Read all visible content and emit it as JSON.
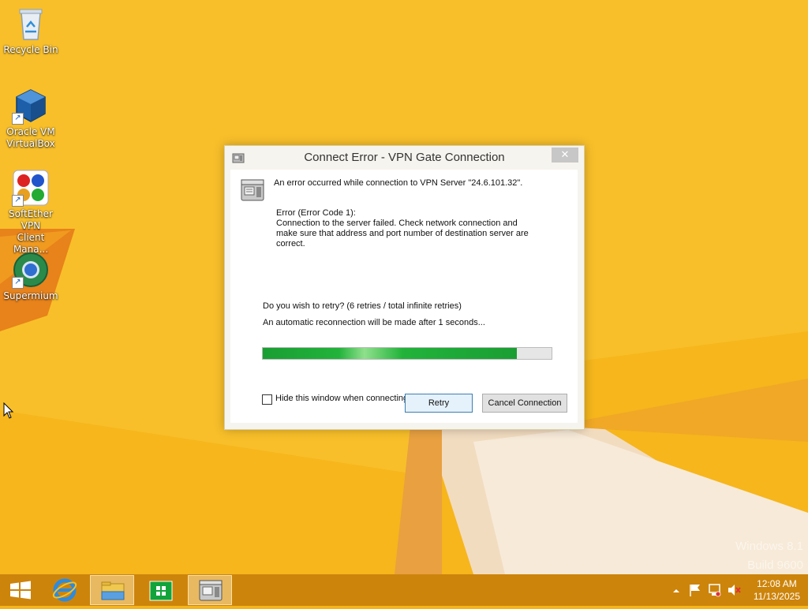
{
  "desktop": {
    "icons": [
      {
        "label": "Recycle Bin",
        "icon": "recycle-bin-icon"
      },
      {
        "label_line1": "Oracle VM",
        "label_line2": "VirtualBox",
        "icon": "virtualbox-icon"
      },
      {
        "label_line1": "SoftEther VPN",
        "label_line2": "Client Mana...",
        "icon": "softether-vpn-icon"
      },
      {
        "label": "Supermium",
        "icon": "supermium-browser-icon"
      }
    ],
    "watermark_line1": "Windows 8.1",
    "watermark_line2": "Build 9600"
  },
  "dialog": {
    "title": "Connect Error - VPN Gate Connection",
    "close_glyph": "✕",
    "message": "An error occurred while connection to VPN Server \"24.6.101.32\".",
    "error_code": "Error (Error Code 1):",
    "error_line1": "Connection to the server failed. Check network connection and",
    "error_line2": "make sure that address and port number of destination server are",
    "error_line3": "correct.",
    "retry_question": "Do you wish to retry? (6 retries / total infinite retries)",
    "auto_reconnect": "An automatic reconnection will be made after 1 seconds...",
    "progress_fraction": 0.88,
    "hide_checkbox_label": "Hide this window when connecting next time",
    "hide_checkbox_checked": false,
    "retry_button": "Retry",
    "cancel_button": "Cancel Connection"
  },
  "taskbar": {
    "items": [
      "start-button",
      "internet-explorer",
      "file-explorer",
      "windows-store",
      "vpn-client"
    ],
    "clock_time": "12:08 AM",
    "clock_date": "11/13/2025"
  },
  "colors": {
    "wallpaper": "#f5b51a",
    "taskbar": "#c9800a",
    "progress_fill": "#22b33b"
  }
}
